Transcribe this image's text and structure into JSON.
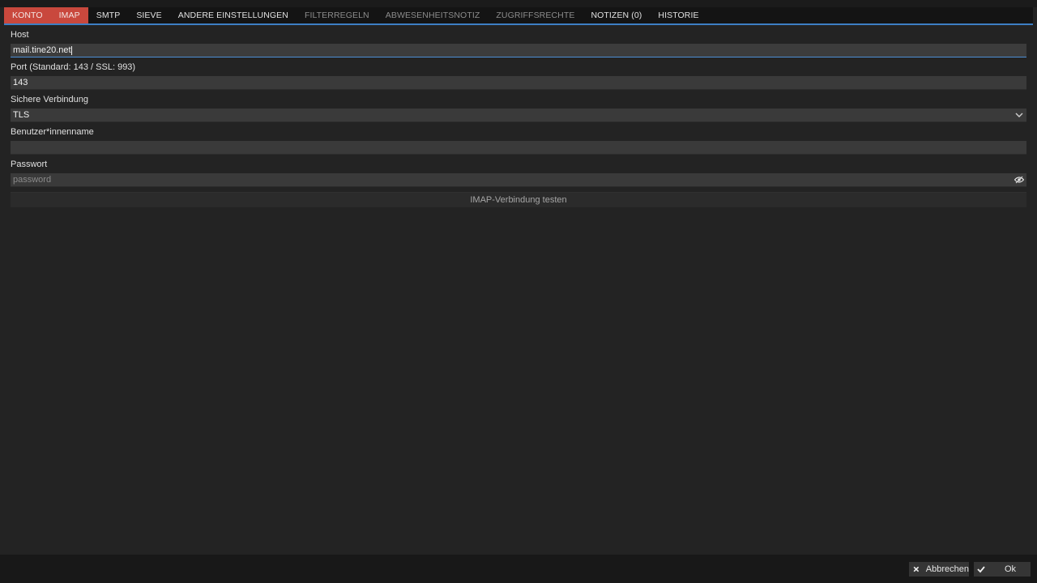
{
  "tabs": [
    {
      "label": "KONTO",
      "style": "red"
    },
    {
      "label": "IMAP",
      "style": "red"
    },
    {
      "label": "SMTP",
      "style": "normal"
    },
    {
      "label": "SIEVE",
      "style": "normal"
    },
    {
      "label": "ANDERE EINSTELLUNGEN",
      "style": "normal"
    },
    {
      "label": "FILTERREGELN",
      "style": "dim"
    },
    {
      "label": "ABWESENHEITSNOTIZ",
      "style": "dim"
    },
    {
      "label": "ZUGRIFFSRECHTE",
      "style": "dim"
    },
    {
      "label": "NOTIZEN (0)",
      "style": "normal"
    },
    {
      "label": "HISTORIE",
      "style": "normal"
    }
  ],
  "form": {
    "host": {
      "label": "Host",
      "value": "mail.tine20.net"
    },
    "port": {
      "label": "Port (Standard: 143 / SSL: 993)",
      "value": "143"
    },
    "secure": {
      "label": "Sichere Verbindung",
      "value": "TLS"
    },
    "username": {
      "label": "Benutzer*innenname",
      "value": ""
    },
    "password": {
      "label": "Passwort",
      "placeholder": "password"
    },
    "test_button": "IMAP-Verbindung testen"
  },
  "footer": {
    "cancel_label": "Abbrechen",
    "ok_label": "Ok"
  },
  "icons": {
    "cancel": "close-icon",
    "ok": "check-icon",
    "password_toggle": "eye-icon",
    "select": "chevron-down-icon"
  },
  "colors": {
    "accent": "#3d7fc4",
    "tab_red": "#c9483d",
    "background": "#232323"
  }
}
